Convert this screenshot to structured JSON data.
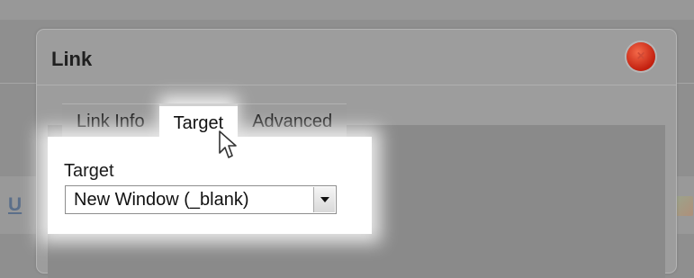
{
  "dialog": {
    "title": "Link",
    "close_icon": "close-icon",
    "close_glyph": "×",
    "tabs": [
      {
        "label": "Link Info",
        "active": false
      },
      {
        "label": "Target",
        "active": true
      },
      {
        "label": "Advanced",
        "active": false
      }
    ],
    "target": {
      "field_label": "Target",
      "selected_value": "New Window (_blank)",
      "arrow_icon": "dropdown-arrow-icon"
    }
  },
  "background": {
    "underline_icon_glyph": "U"
  },
  "colors": {
    "overlay": "#8f8f8f",
    "close_red": "#d9331a",
    "highlight": "#ffffff"
  }
}
